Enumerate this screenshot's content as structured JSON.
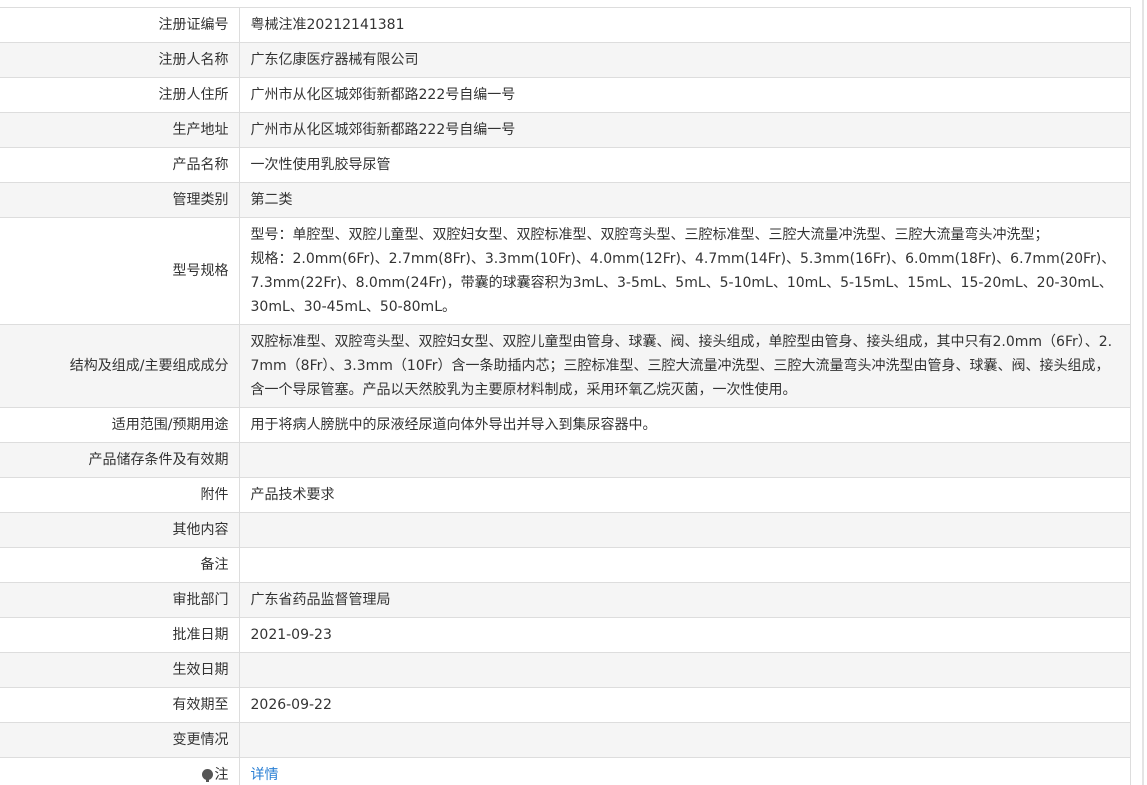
{
  "rows": [
    {
      "label": "注册证编号",
      "value": "粤械注准20212141381"
    },
    {
      "label": "注册人名称",
      "value": "广东亿康医疗器械有限公司"
    },
    {
      "label": "注册人住所",
      "value": "广州市从化区城郊街新都路222号自编一号"
    },
    {
      "label": "生产地址",
      "value": "广州市从化区城郊街新都路222号自编一号"
    },
    {
      "label": "产品名称",
      "value": "一次性使用乳胶导尿管"
    },
    {
      "label": "管理类别",
      "value": "第二类"
    },
    {
      "label": "型号规格",
      "value_line1": "型号：单腔型、双腔儿童型、双腔妇女型、双腔标准型、双腔弯头型、三腔标准型、三腔大流量冲洗型、三腔大流量弯头冲洗型；",
      "value_line2": "规格：2.0mm(6Fr)、2.7mm(8Fr)、3.3mm(10Fr)、4.0mm(12Fr)、4.7mm(14Fr)、5.3mm(16Fr)、6.0mm(18Fr)、6.7mm(20Fr)、7.3mm(22Fr)、8.0mm(24Fr)，带囊的球囊容积为3mL、3-5mL、5mL、5-10mL、10mL、5-15mL、15mL、15-20mL、20-30mL、30mL、30-45mL、50-80mL。"
    },
    {
      "label": "结构及组成/主要组成成分",
      "value": "双腔标准型、双腔弯头型、双腔妇女型、双腔儿童型由管身、球囊、阀、接头组成，单腔型由管身、接头组成，其中只有2.0mm（6Fr）、2.7mm（8Fr）、3.3mm（10Fr）含一条助插内芯；三腔标准型、三腔大流量冲洗型、三腔大流量弯头冲洗型由管身、球囊、阀、接头组成，含一个导尿管塞。产品以天然胶乳为主要原材料制成，采用环氧乙烷灭菌，一次性使用。"
    },
    {
      "label": "适用范围/预期用途",
      "value": "用于将病人膀胱中的尿液经尿道向体外导出并导入到集尿容器中。"
    },
    {
      "label": "产品储存条件及有效期",
      "value": ""
    },
    {
      "label": "附件",
      "value": "产品技术要求"
    },
    {
      "label": "其他内容",
      "value": ""
    },
    {
      "label": "备注",
      "value": ""
    },
    {
      "label": "审批部门",
      "value": "广东省药品监督管理局"
    },
    {
      "label": "批准日期",
      "value": "2021-09-23"
    },
    {
      "label": "生效日期",
      "value": ""
    },
    {
      "label": "有效期至",
      "value": "2026-09-22"
    },
    {
      "label": "变更情况",
      "value": ""
    },
    {
      "label": "注",
      "value": "详情"
    }
  ],
  "icons": {
    "note": "lightbulb-icon"
  },
  "colors": {
    "link": "#2a7fd4",
    "alt_row": "#f5f5f5",
    "border": "#dddddd"
  }
}
